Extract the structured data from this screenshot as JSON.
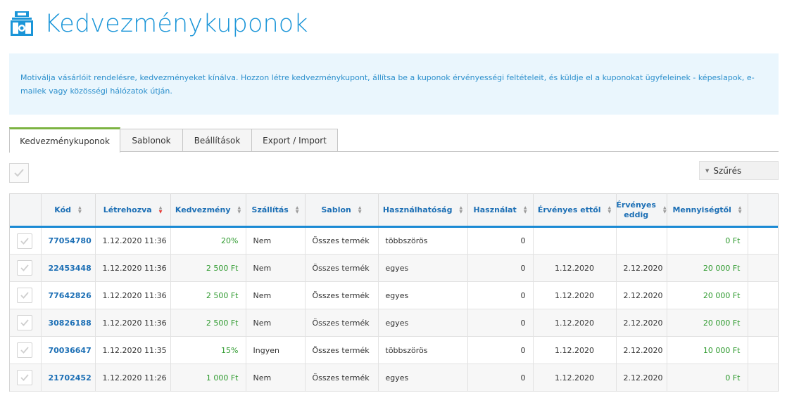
{
  "page": {
    "title": "Kedvezménykuponok",
    "logo_icon": "coupon-bag-icon",
    "info_text": "Motiválja vásárlóit rendelésre, kedvezményeket kínálva. Hozzon létre kedvezménykupont, állítsa be a kuponok érvényességi feltételeit, és küldje el a kuponokat ügyfeleinek - képeslapok, e-mailek vagy közösségi hálózatok útján."
  },
  "tabs": [
    {
      "label": "Kedvezménykuponok",
      "active": true
    },
    {
      "label": "Sablonok",
      "active": false
    },
    {
      "label": "Beállítások",
      "active": false
    },
    {
      "label": "Export / Import",
      "active": false
    }
  ],
  "toolbar": {
    "filter_label": "Szűrés",
    "filter_icon": "caret-down-icon",
    "select_all_icon": "checkmark-icon"
  },
  "colors": {
    "accent": "#1a95d8",
    "tab_active": "#7cb342",
    "positive": "#2e9a2e",
    "sort_active": "#e53935"
  },
  "table": {
    "columns": [
      {
        "label": "",
        "sortable": false
      },
      {
        "label": "Kód",
        "sortable": true
      },
      {
        "label": "Létrehozva",
        "sortable": true,
        "sorted": "desc"
      },
      {
        "label": "Kedvezmény",
        "sortable": true
      },
      {
        "label": "Szállítás",
        "sortable": true
      },
      {
        "label": "Sablon",
        "sortable": true
      },
      {
        "label": "Használhatóság",
        "sortable": true
      },
      {
        "label": "Használat",
        "sortable": true
      },
      {
        "label": "Érvényes ettől",
        "sortable": true
      },
      {
        "label": "Érvényes eddig",
        "sortable": true
      },
      {
        "label": "Mennyiségtől",
        "sortable": true
      },
      {
        "label": "",
        "sortable": false
      }
    ],
    "rows": [
      {
        "code": "77054780",
        "created": "1.12.2020 11:36",
        "discount": "20%",
        "shipping": "Nem",
        "template": "Összes termék",
        "usability": "többszörös",
        "usage": "0",
        "valid_from": "",
        "valid_to": "",
        "min_amount": "0 Ft"
      },
      {
        "code": "22453448",
        "created": "1.12.2020 11:36",
        "discount": "2 500 Ft",
        "shipping": "Nem",
        "template": "Összes termék",
        "usability": "egyes",
        "usage": "0",
        "valid_from": "1.12.2020",
        "valid_to": "2.12.2020",
        "min_amount": "20 000 Ft"
      },
      {
        "code": "77642826",
        "created": "1.12.2020 11:36",
        "discount": "2 500 Ft",
        "shipping": "Nem",
        "template": "Összes termék",
        "usability": "egyes",
        "usage": "0",
        "valid_from": "1.12.2020",
        "valid_to": "2.12.2020",
        "min_amount": "20 000 Ft"
      },
      {
        "code": "30826188",
        "created": "1.12.2020 11:36",
        "discount": "2 500 Ft",
        "shipping": "Nem",
        "template": "Összes termék",
        "usability": "egyes",
        "usage": "0",
        "valid_from": "1.12.2020",
        "valid_to": "2.12.2020",
        "min_amount": "20 000 Ft"
      },
      {
        "code": "70036647",
        "created": "1.12.2020 11:35",
        "discount": "15%",
        "shipping": "Ingyen",
        "template": "Összes termék",
        "usability": "többszörös",
        "usage": "0",
        "valid_from": "1.12.2020",
        "valid_to": "2.12.2020",
        "min_amount": "10 000 Ft"
      },
      {
        "code": "21702452",
        "created": "1.12.2020 11:26",
        "discount": "1 000 Ft",
        "shipping": "Nem",
        "template": "Összes termék",
        "usability": "egyes",
        "usage": "0",
        "valid_from": "1.12.2020",
        "valid_to": "2.12.2020",
        "min_amount": "0 Ft"
      }
    ]
  }
}
